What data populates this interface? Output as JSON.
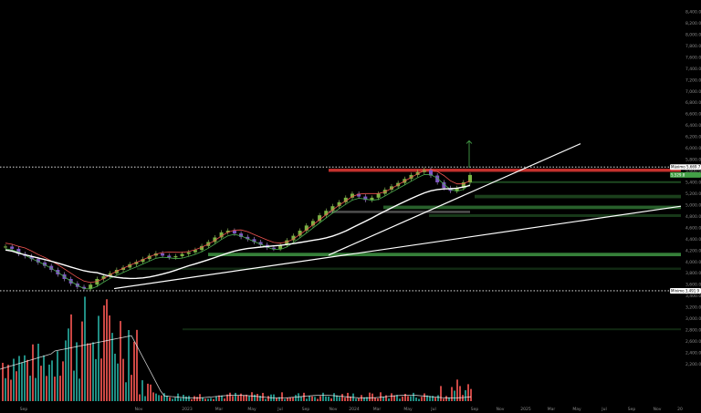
{
  "chart_data": {
    "type": "candlestick",
    "yaxis": {
      "ticks": [
        "8,400.0",
        "8,200.0",
        "8,000.0",
        "7,800.0",
        "7,600.0",
        "7,400.0",
        "7,200.0",
        "7,000.0",
        "6,800.0",
        "6,600.0",
        "6,400.0",
        "6,200.0",
        "6,000.0",
        "5,800.0",
        "5,600.0",
        "5,400.0",
        "5,200.0",
        "5,000.0",
        "4,800.0",
        "4,600.0",
        "4,400.0",
        "4,200.0",
        "4,000.0",
        "3,800.0",
        "3,600.0",
        "3,400.0",
        "3,200.0",
        "3,000.0",
        "2,800.0",
        "2,600.0",
        "2,400.0",
        "2,200.0"
      ],
      "ylim": [
        2100,
        8500
      ]
    },
    "xaxis": {
      "ticks": [
        "Sep",
        "Nov",
        "2023",
        "Mar",
        "May",
        "Jul",
        "Sep",
        "Nov",
        "2024",
        "Mar",
        "May",
        "Jul",
        "Sep",
        "Nov",
        "2025",
        "Mar",
        "May",
        "Jul",
        "Sep",
        "Nov",
        "20"
      ]
    },
    "tags": {
      "high_label": "Máximo",
      "high_value": "5,669.7",
      "last_value": "5,529.8",
      "low_label": "Mínimo",
      "low_value": "3,491.9"
    },
    "levels": {
      "high": 5669.7,
      "last": 5529.8,
      "low": 3491.9
    },
    "colors": {
      "up": "#4caf50",
      "down": "#ef5350",
      "candle_down": "#7e57c2",
      "ma_white": "#ffffff",
      "zone_red": "#e53935",
      "zone_green": "#43a047"
    },
    "series": [
      {
        "values": [
          4270,
          4230,
          4140,
          4100,
          4050,
          3990,
          3930,
          3860,
          3780,
          3700,
          3620,
          3560,
          3530,
          3600,
          3700,
          3750,
          3800,
          3860,
          3900,
          3960,
          4000,
          4050,
          4110,
          4150,
          4110,
          4080,
          4100,
          4140,
          4170,
          4210,
          4280,
          4350,
          4430,
          4520,
          4550,
          4500,
          4440,
          4400,
          4350,
          4300,
          4250,
          4230,
          4300,
          4380,
          4460,
          4550,
          4640,
          4720,
          4820,
          4900,
          4980,
          5050,
          5130,
          5200,
          5150,
          5090,
          5130,
          5200,
          5270,
          5330,
          5390,
          5460,
          5530,
          5580,
          5620,
          5520,
          5400,
          5300,
          5250,
          5300,
          5400,
          5530
        ]
      }
    ]
  }
}
